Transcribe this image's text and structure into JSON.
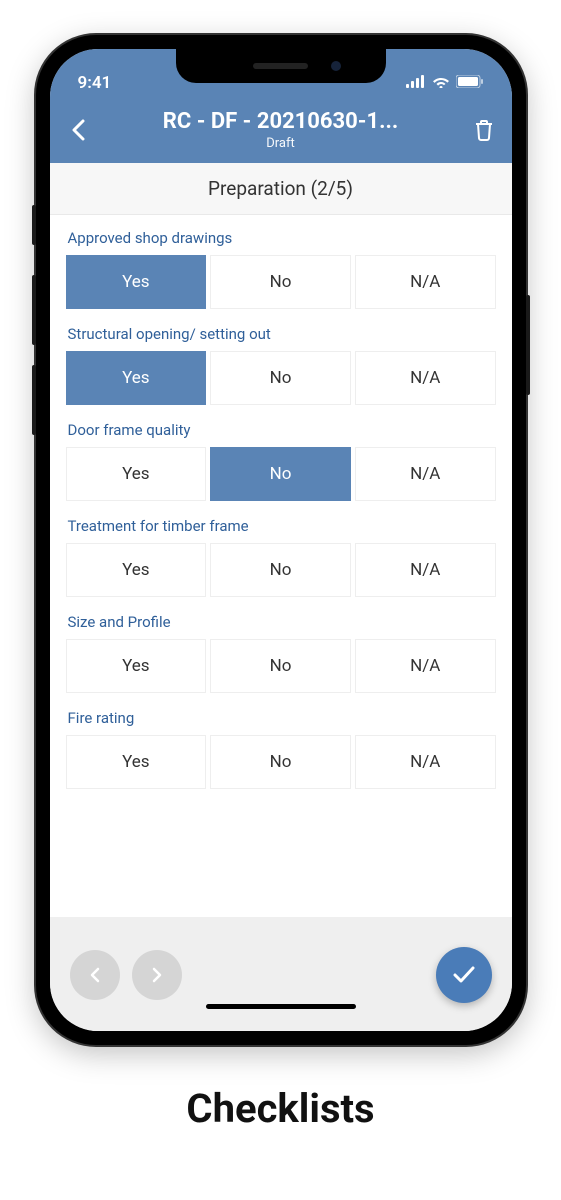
{
  "status": {
    "time": "9:41"
  },
  "header": {
    "title": "RC - DF - 20210630-1...",
    "subtitle": "Draft"
  },
  "section": {
    "title": "Preparation (2/5)"
  },
  "options": {
    "yes": "Yes",
    "no": "No",
    "na": "N/A"
  },
  "questions": [
    {
      "label": "Approved shop drawings",
      "selected": "yes"
    },
    {
      "label": "Structural opening/ setting out",
      "selected": "yes"
    },
    {
      "label": "Door frame quality",
      "selected": "no"
    },
    {
      "label": "Treatment for timber frame",
      "selected": ""
    },
    {
      "label": "Size and Profile",
      "selected": ""
    },
    {
      "label": "Fire rating",
      "selected": ""
    }
  ],
  "caption": "Checklists"
}
